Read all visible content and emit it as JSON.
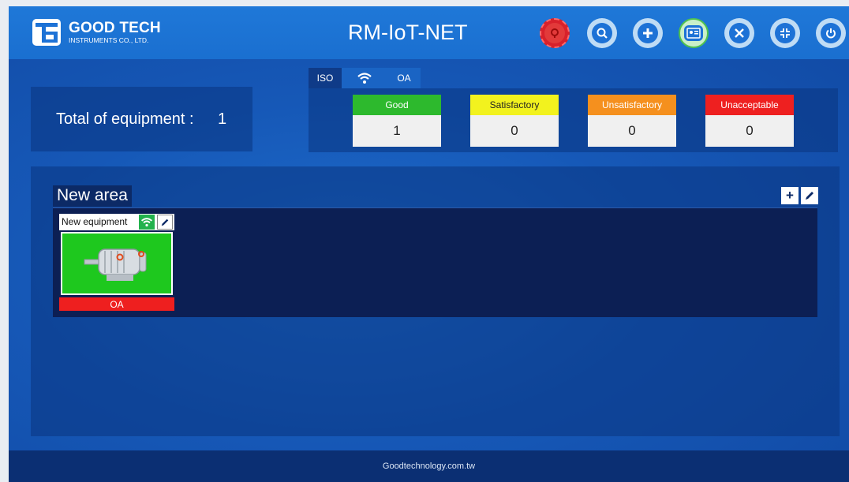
{
  "header": {
    "brand": "GOOD TECH",
    "brand_sub": "INSTRUMENTS CO., LTD.",
    "title": "RM-IoT-NET",
    "buttons": [
      {
        "name": "alarm-icon"
      },
      {
        "name": "search-icon"
      },
      {
        "name": "add-icon"
      },
      {
        "name": "id-card-icon"
      },
      {
        "name": "tools-icon"
      },
      {
        "name": "compress-icon"
      },
      {
        "name": "power-icon"
      }
    ]
  },
  "summary": {
    "total_label": "Total of equipment :",
    "total_value": "1"
  },
  "tabs": {
    "iso": "ISO",
    "oa": "OA"
  },
  "status_cards": [
    {
      "label": "Good",
      "value": "1",
      "color": "#2db92d",
      "text_color": "#ffffff"
    },
    {
      "label": "Satisfactory",
      "value": "0",
      "color": "#f2f21e",
      "text_color": "#222222"
    },
    {
      "label": "Unsatisfactory",
      "value": "0",
      "color": "#f5901e",
      "text_color": "#ffffff"
    },
    {
      "label": "Unacceptable",
      "value": "0",
      "color": "#ee2020",
      "text_color": "#ffffff"
    }
  ],
  "area": {
    "title": "New area",
    "equipment": {
      "name": "New equipment",
      "status": "OA"
    }
  },
  "footer": {
    "text": "Goodtechnology.com.tw"
  }
}
